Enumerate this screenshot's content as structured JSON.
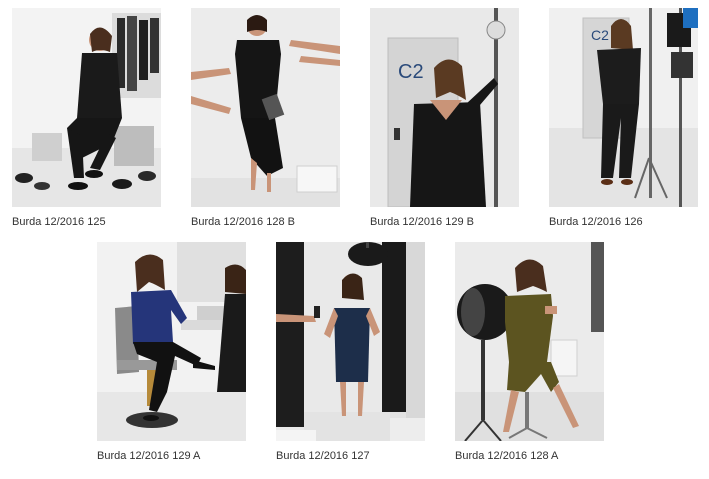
{
  "gallery": {
    "items": [
      {
        "caption": "Burda 12/2016 125",
        "icon": "photo-woman-black-blazer-seated",
        "bg": "#f2f2f2",
        "garment": "#1a1a1a",
        "skin": "#c99478"
      },
      {
        "caption": "Burda 12/2016 128 B",
        "icon": "photo-woman-black-wrap-dress",
        "bg": "#ececec",
        "garment": "#151515",
        "skin": "#c99478"
      },
      {
        "caption": "Burda 12/2016 129 B",
        "icon": "photo-woman-black-blouse-door",
        "bg": "#e8e8e8",
        "garment": "#161616",
        "skin": "#c99478"
      },
      {
        "caption": "Burda 12/2016 126",
        "icon": "photo-woman-black-jumpsuit",
        "bg": "#f0f0f0",
        "garment": "#1c1c1c",
        "skin": "#c99478"
      },
      {
        "caption": "Burda 12/2016 129 A",
        "icon": "photo-woman-blue-blouse-salon",
        "bg": "#f1f1f1",
        "garment": "#25357a",
        "skin": "#c99478"
      },
      {
        "caption": "Burda 12/2016 127",
        "icon": "photo-woman-blue-lace-dress",
        "bg": "#e9e9e9",
        "garment": "#1d2e4a",
        "skin": "#c99478"
      },
      {
        "caption": "Burda 12/2016 128 A",
        "icon": "photo-woman-olive-dress-seated",
        "bg": "#ebebeb",
        "garment": "#5c5420",
        "skin": "#c99478"
      }
    ]
  }
}
